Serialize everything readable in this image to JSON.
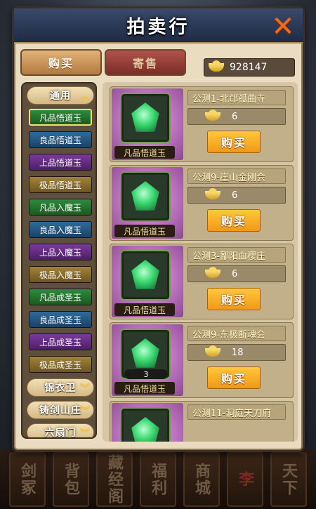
{
  "header": {
    "title": "拍卖行"
  },
  "tabs": {
    "buy": "购买",
    "sell": "寄售"
  },
  "gold": "928147",
  "categories": [
    {
      "label": "通用",
      "items": [
        "凡品悟道玉",
        "良品悟道玉",
        "上品悟道玉",
        "极品悟道玉",
        "凡品入魔玉",
        "良品入魔玉",
        "上品入魔玉",
        "极品入魔玉",
        "凡品成圣玉",
        "良品成圣玉",
        "上品成圣玉",
        "极品成圣玉"
      ]
    },
    {
      "label": "锦衣卫"
    },
    {
      "label": "铸剑山庄"
    },
    {
      "label": "六扇门"
    }
  ],
  "listings": [
    {
      "seller": "公测1-北邙孤曲寺",
      "price": "6",
      "item": "凡品悟道玉",
      "qty": "",
      "buy": "购买"
    },
    {
      "seller": "公测9-崖山金刚会",
      "price": "6",
      "item": "凡品悟道玉",
      "qty": "",
      "buy": "购买"
    },
    {
      "seller": "公测3-鄱阳血樱庄",
      "price": "6",
      "item": "凡品悟道玉",
      "qty": "",
      "buy": "购买"
    },
    {
      "seller": "公测9-东极断魂会",
      "price": "18",
      "item": "凡品悟道玉",
      "qty": "3",
      "buy": "购买"
    },
    {
      "seller": "公测11-洞庭天刀府",
      "price": "",
      "item": "",
      "qty": "",
      "buy": ""
    }
  ],
  "bottom_nav": [
    "剑冢",
    "背包",
    "藏经阁",
    "福利",
    "商城",
    "李",
    "天下"
  ]
}
